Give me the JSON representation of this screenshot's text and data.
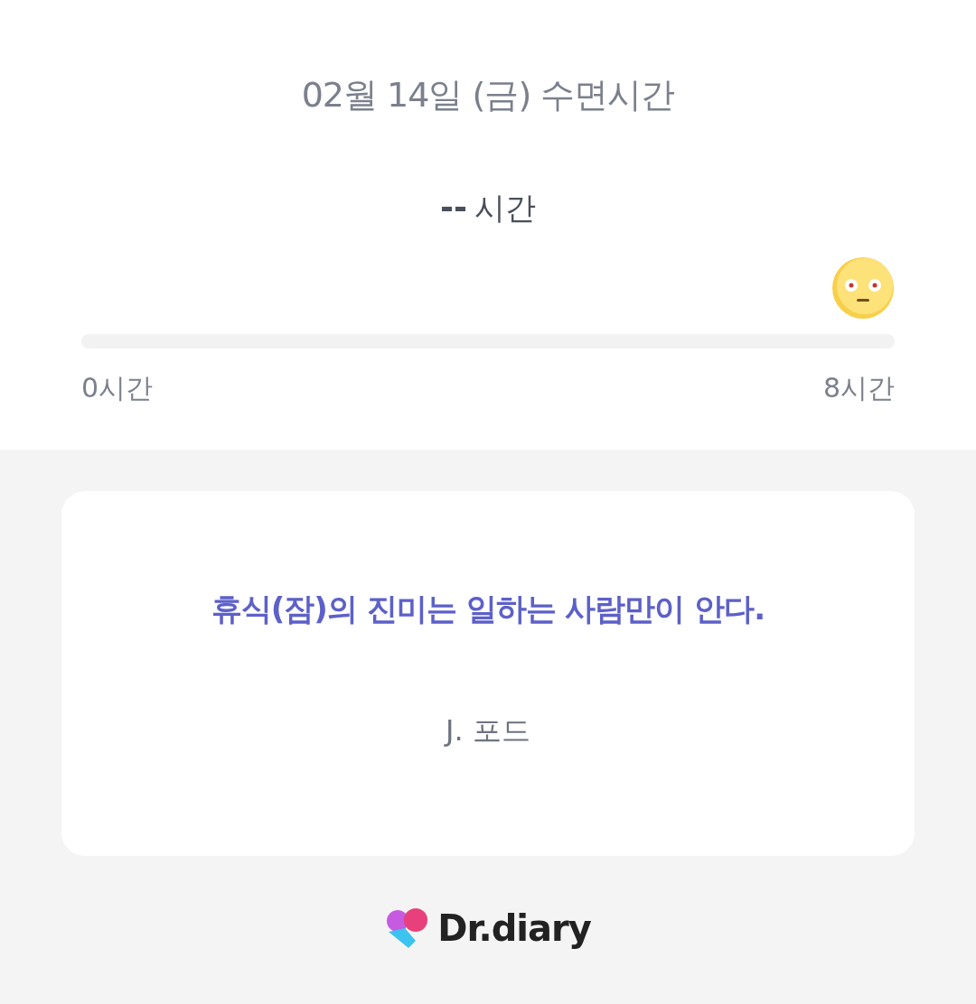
{
  "header": {
    "title": "02월 14일 (금) 수면시간"
  },
  "sleep": {
    "value": "--",
    "unit": "시간",
    "level": 0,
    "min_label": "0시간",
    "max_label": "8시간"
  },
  "quote": {
    "text": "휴식(잠)의 진미는 일하는 사람만이 안다.",
    "author": "J. 포드"
  },
  "footer": {
    "brand": "Dr.diary"
  }
}
